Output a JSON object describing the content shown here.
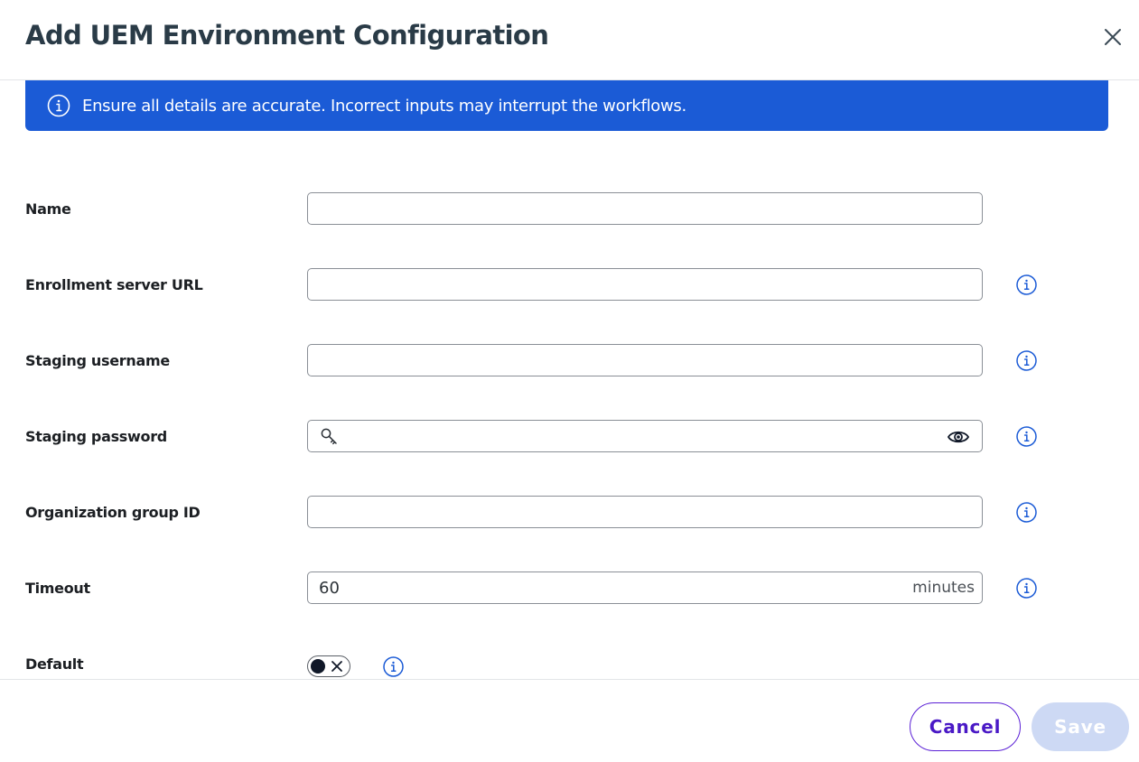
{
  "dialog": {
    "title": "Add UEM Environment Configuration"
  },
  "banner": {
    "message": "Ensure all details are accurate. Incorrect inputs may interrupt the workflows.",
    "color": "#1b5bd6"
  },
  "form": {
    "name": {
      "label": "Name",
      "value": ""
    },
    "enrollment_url": {
      "label": "Enrollment server URL",
      "value": ""
    },
    "staging_username": {
      "label": "Staging username",
      "value": ""
    },
    "staging_password": {
      "label": "Staging password",
      "value": ""
    },
    "org_group_id": {
      "label": "Organization group ID",
      "value": ""
    },
    "timeout": {
      "label": "Timeout",
      "value": "60",
      "unit": "minutes"
    },
    "default": {
      "label": "Default",
      "enabled": false
    }
  },
  "footer": {
    "cancel_label": "Cancel",
    "save_label": "Save"
  },
  "colors": {
    "accent": "#4a19c6",
    "info_icon": "#1b5bd6",
    "save_disabled": "#cdd9f4"
  },
  "icons": {
    "close": "close-icon",
    "info": "info-icon",
    "key": "key-icon",
    "eye": "eye-icon",
    "toggle_off": "x-icon"
  }
}
